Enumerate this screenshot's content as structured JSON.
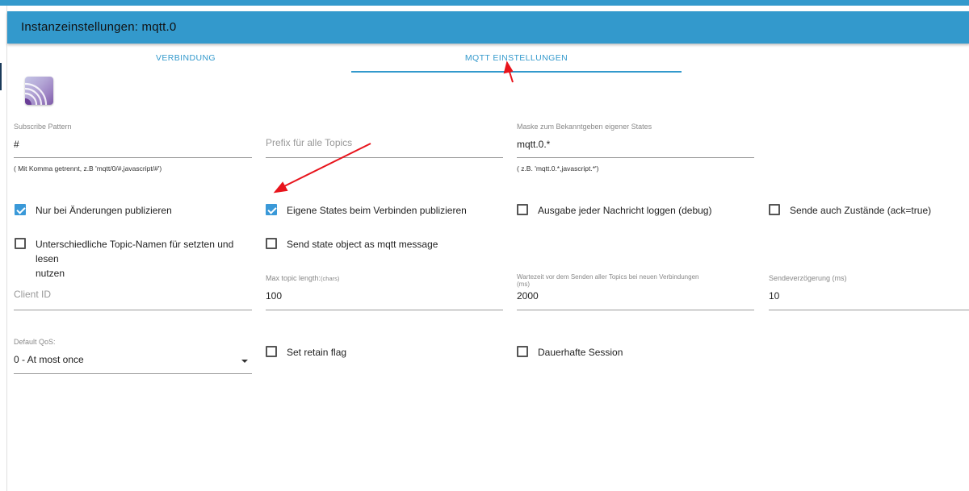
{
  "dialog": {
    "title": "Instanzeinstellungen: mqtt.0"
  },
  "tabs": [
    {
      "label": "VERBINDUNG",
      "active": false
    },
    {
      "label": "MQTT EINSTELLUNGEN",
      "active": true
    }
  ],
  "logo": {
    "icon": "mqtt-logo-icon"
  },
  "fields": {
    "subscribe_pattern": {
      "label": "Subscribe Pattern",
      "value": "#",
      "help": "( Mit Komma getrennt, z.B 'mqtt/0/#,javascript/#')"
    },
    "prefix": {
      "placeholder": "Prefix für alle Topics"
    },
    "mask": {
      "label": "Maske zum Bekanntgeben eigener States",
      "value": "mqtt.0.*",
      "help": "( z.B. 'mqtt.0.*,javascript.*')"
    },
    "client_id": {
      "placeholder": "Client ID"
    },
    "max_topic_length": {
      "label": "Max topic length:",
      "unit": "(chars)",
      "value": "100"
    },
    "wait_time": {
      "label_line1": "Wartezeit vor dem Senden aller Topics bei neuen Verbindungen",
      "label_line2": "(ms)",
      "value": "2000"
    },
    "send_delay": {
      "label": "Sendeverzögerung (ms)",
      "value": "10"
    },
    "default_qos": {
      "label": "Default QoS:",
      "value": "0 - At most once"
    }
  },
  "checkboxes": {
    "only_changes": {
      "label": "Nur bei Änderungen publizieren",
      "checked": true
    },
    "own_states": {
      "label": "Eigene States beim Verbinden publizieren",
      "checked": true
    },
    "log_messages": {
      "label": "Ausgabe jeder Nachricht loggen (debug)",
      "checked": false
    },
    "send_ack": {
      "label": "Sende auch Zustände (ack=true)",
      "checked": false
    },
    "different_topics_line1": "Unterschiedliche Topic-Namen für setzten und lesen",
    "different_topics_line2": "nutzen",
    "different_topics": {
      "checked": false
    },
    "state_object": {
      "label": "Send state object as mqtt message",
      "checked": false
    },
    "retain": {
      "label": "Set retain flag",
      "checked": false
    },
    "persistent_session": {
      "label": "Dauerhafte Session",
      "checked": false
    }
  },
  "colors": {
    "accent": "#3399cc",
    "checkbox": "#3a99d8",
    "annotation_arrow": "#e8141c"
  }
}
